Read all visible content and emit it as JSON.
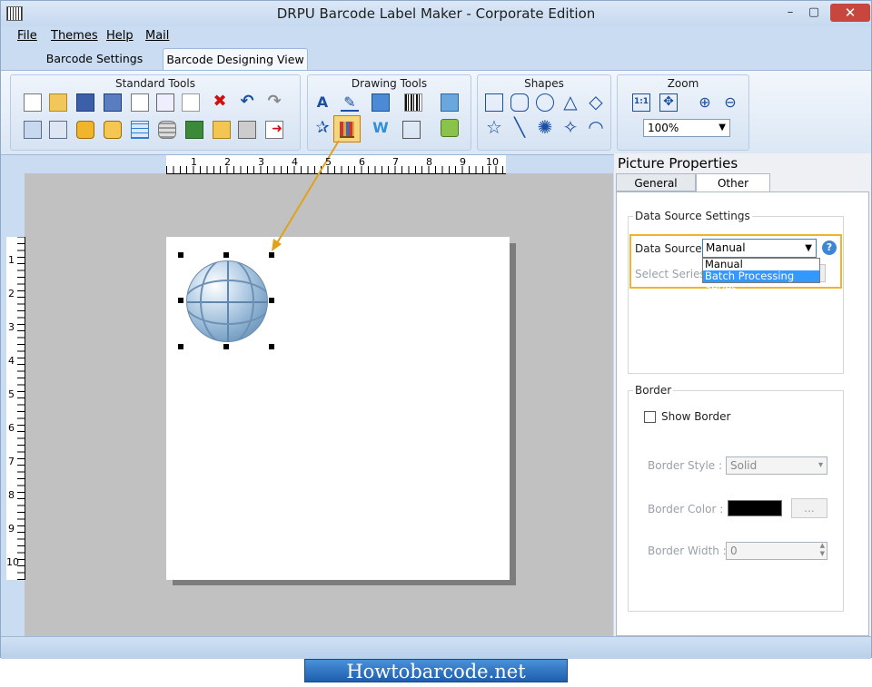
{
  "window": {
    "title": "DRPU Barcode Label Maker - Corporate Edition",
    "minimize": "–",
    "maximize": "▢",
    "close": "✕"
  },
  "menu": [
    "File",
    "Themes",
    "Help",
    "Mail"
  ],
  "tabs": [
    "Barcode Settings",
    "Barcode Designing View"
  ],
  "ribbon": {
    "standard_tools": "Standard Tools",
    "drawing_tools": "Drawing Tools",
    "shapes": "Shapes",
    "zoom": "Zoom",
    "zoom_value": "100%",
    "zoom_fit": "1:1"
  },
  "ruler": {
    "h": [
      "1",
      "2",
      "3",
      "4",
      "5",
      "6",
      "7",
      "8",
      "9",
      "10"
    ],
    "v": [
      "1",
      "2",
      "3",
      "4",
      "5",
      "6",
      "7",
      "8",
      "9",
      "10"
    ]
  },
  "panel": {
    "title": "Picture Properties",
    "tabs": [
      "General Settings",
      "Other Settings"
    ],
    "data_source_group": "Data Source Settings",
    "data_source_label": "Data Source :",
    "data_source_value": "Manual",
    "dropdown_options": [
      "Manual",
      "Batch Processing Series"
    ],
    "select_series_label": "Select Series :",
    "view_btn": "w",
    "help": "?",
    "border_group": "Border",
    "show_border": "Show Border",
    "border_style_label": "Border Style :",
    "border_style_value": "Solid",
    "border_color_label": "Border Color :",
    "border_color_value": "#000000",
    "border_color_btn": "...",
    "border_width_label": "Border Width :",
    "border_width_value": "0"
  },
  "watermark": "Howtobarcode.net"
}
